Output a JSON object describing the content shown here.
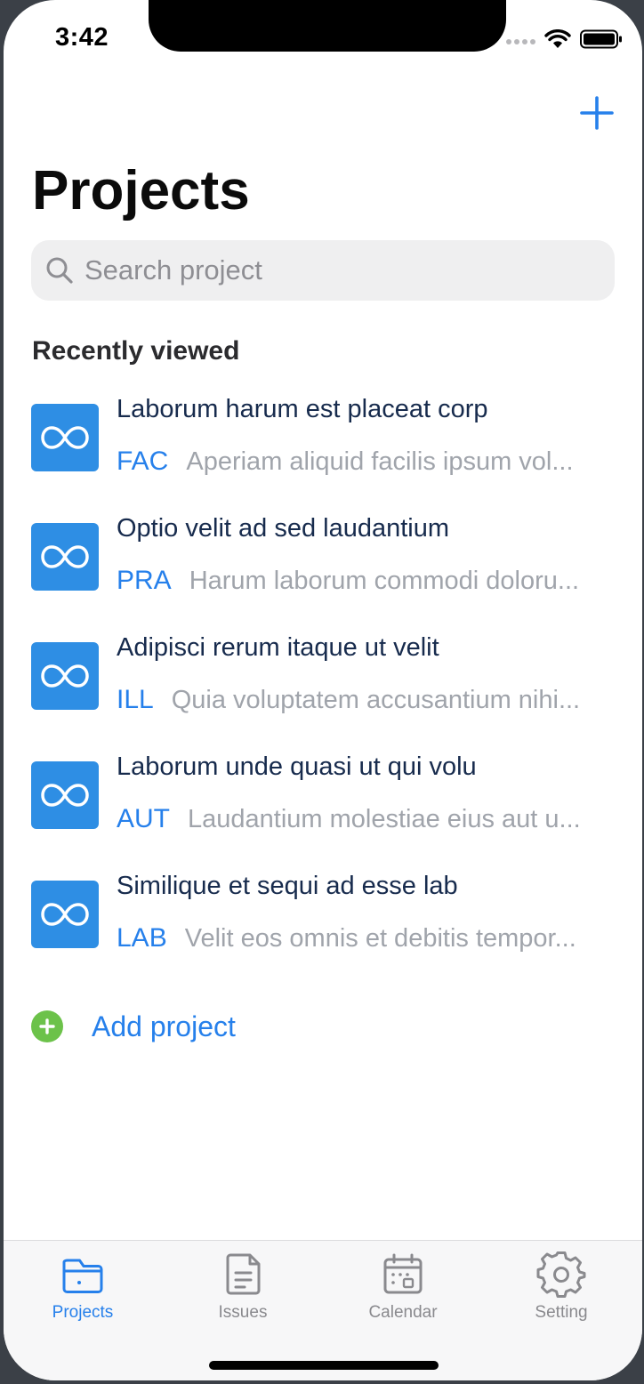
{
  "status_bar": {
    "time": "3:42"
  },
  "header": {
    "title": "Projects",
    "add_icon": "plus-icon"
  },
  "search": {
    "placeholder": "Search project",
    "value": ""
  },
  "recent": {
    "title": "Recently viewed",
    "projects": [
      {
        "name": "Laborum harum est placeat corp",
        "key": "FAC",
        "description": "Aperiam aliquid facilis ipsum vol..."
      },
      {
        "name": "Optio velit ad sed laudantium",
        "key": "PRA",
        "description": "Harum laborum commodi doloru..."
      },
      {
        "name": "Adipisci rerum itaque ut velit",
        "key": "ILL",
        "description": "Quia voluptatem accusantium nihi..."
      },
      {
        "name": "Laborum unde quasi ut qui volu",
        "key": "AUT",
        "description": "Laudantium molestiae eius aut u..."
      },
      {
        "name": "Similique et sequi ad esse lab",
        "key": "LAB",
        "description": "Velit eos omnis et debitis tempor..."
      }
    ]
  },
  "add_project": {
    "label": "Add project"
  },
  "tabbar": {
    "tabs": [
      {
        "label": "Projects",
        "icon": "folder-icon",
        "active": true
      },
      {
        "label": "Issues",
        "icon": "document-icon",
        "active": false
      },
      {
        "label": "Calendar",
        "icon": "calendar-icon",
        "active": false
      },
      {
        "label": "Setting",
        "icon": "gear-icon",
        "active": false
      }
    ]
  },
  "colors": {
    "accent": "#2680eb",
    "avatar": "#2e8ee4",
    "add": "#6cc24a"
  }
}
